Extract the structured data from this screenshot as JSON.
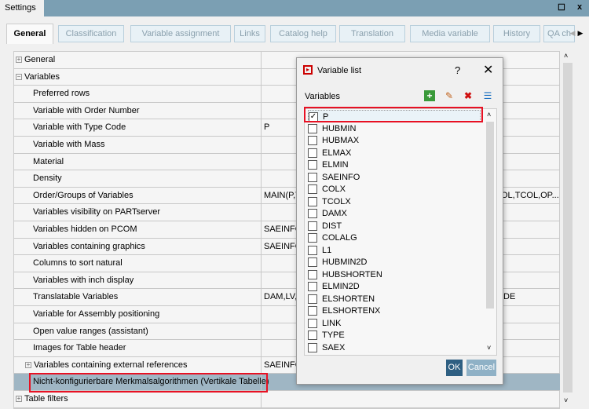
{
  "window": {
    "title": "Settings",
    "maximize_icon": "maximize-icon",
    "close_icon": "close-icon"
  },
  "tabs": [
    {
      "label": "General",
      "active": true
    },
    {
      "label": "Classification"
    },
    {
      "label": "Variable assignment"
    },
    {
      "label": "Links"
    },
    {
      "label": "Catalog help"
    },
    {
      "label": "Translation"
    },
    {
      "label": "Media variable"
    },
    {
      "label": "History"
    },
    {
      "label": "QA ch"
    }
  ],
  "tree": {
    "rows": [
      {
        "label": "General",
        "value": "",
        "level": 0,
        "expander": "+"
      },
      {
        "label": "Variables",
        "value": "",
        "level": 0,
        "expander": "-"
      },
      {
        "label": "Preferred rows",
        "value": "",
        "level": 1
      },
      {
        "label": "Variable with Order Number",
        "value": "",
        "level": 1
      },
      {
        "label": "Variable with Type Code",
        "value": "P",
        "level": 1
      },
      {
        "label": "Variable with Mass",
        "value": "",
        "level": 1
      },
      {
        "label": "Material",
        "value": "",
        "level": 1
      },
      {
        "label": "Density",
        "value": "",
        "level": 1
      },
      {
        "label": "Order/Groups of Variables",
        "value": "MAIN(P,T",
        "value_tail": "OL,TCOL,OP...",
        "level": 1
      },
      {
        "label": "Variables visibility on PARTserver",
        "value": "",
        "level": 1
      },
      {
        "label": "Variables hidden on PCOM",
        "value": "SAEINFO,",
        "level": 1
      },
      {
        "label": "Variables containing graphics",
        "value": "SAEINFO,",
        "level": 1
      },
      {
        "label": "Columns to sort natural",
        "value": "",
        "level": 1
      },
      {
        "label": "Variables with inch display",
        "value": "",
        "level": 1
      },
      {
        "label": "Translatable Variables",
        "value": "DAM,LV,L",
        "value_tail": ",DE",
        "level": 1
      },
      {
        "label": "Variable for Assembly positioning",
        "value": "",
        "level": 1
      },
      {
        "label": "Open value ranges (assistant)",
        "value": "",
        "level": 1
      },
      {
        "label": "Images for Table header",
        "value": "",
        "level": 1
      },
      {
        "label": "Variables containing external references",
        "value": "SAEINFO,",
        "level": 1,
        "expander": "+"
      },
      {
        "label": "Nicht-konfigurierbare Merkmalsalgorithmen (Vertikale Tabelle)",
        "value": "",
        "level": 1,
        "selected": true
      },
      {
        "label": "Table filters",
        "value": "",
        "level": 0,
        "expander": "+"
      }
    ]
  },
  "dialog": {
    "title": "Variable list",
    "help": "?",
    "close": "✕",
    "variables_label": "Variables",
    "toolbar": [
      "add-variable-icon",
      "edit-variable-icon",
      "delete-variable-icon",
      "list-view-icon"
    ],
    "items": [
      {
        "name": "P",
        "checked": true
      },
      {
        "name": "HUBMIN"
      },
      {
        "name": "HUBMAX"
      },
      {
        "name": "ELMAX"
      },
      {
        "name": "ELMIN"
      },
      {
        "name": "SAEINFO"
      },
      {
        "name": "COLX"
      },
      {
        "name": "TCOLX"
      },
      {
        "name": "DAMX"
      },
      {
        "name": "DIST"
      },
      {
        "name": "COLALG"
      },
      {
        "name": "L1"
      },
      {
        "name": "HUBMIN2D"
      },
      {
        "name": "HUBSHORTEN"
      },
      {
        "name": "ELMIN2D"
      },
      {
        "name": "ELSHORTEN"
      },
      {
        "name": "ELSHORTENX"
      },
      {
        "name": "LINK"
      },
      {
        "name": "TYPE"
      },
      {
        "name": "SAEX"
      }
    ],
    "ok": "OK",
    "cancel": "Cancel"
  },
  "colors": {
    "titlebar": "#7b9fb3",
    "selection": "#9fb6c4",
    "highlight": "#e81123",
    "ok": "#2e5f82",
    "cancel": "#8fb1c6"
  }
}
